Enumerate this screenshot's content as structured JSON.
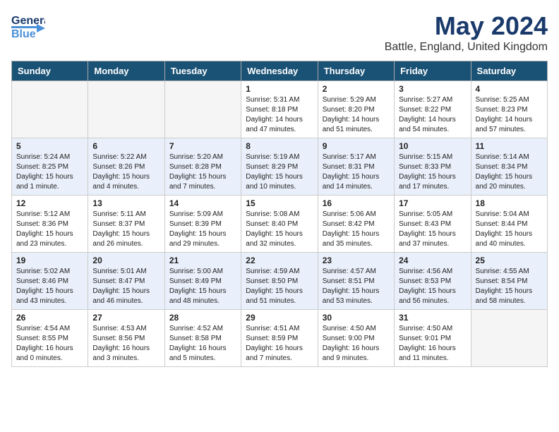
{
  "header": {
    "logo_line1": "General",
    "logo_line2": "Blue",
    "title": "May 2024",
    "subtitle": "Battle, England, United Kingdom"
  },
  "days_of_week": [
    "Sunday",
    "Monday",
    "Tuesday",
    "Wednesday",
    "Thursday",
    "Friday",
    "Saturday"
  ],
  "weeks": [
    [
      {
        "day": "",
        "info": ""
      },
      {
        "day": "",
        "info": ""
      },
      {
        "day": "",
        "info": ""
      },
      {
        "day": "1",
        "info": "Sunrise: 5:31 AM\nSunset: 8:18 PM\nDaylight: 14 hours\nand 47 minutes."
      },
      {
        "day": "2",
        "info": "Sunrise: 5:29 AM\nSunset: 8:20 PM\nDaylight: 14 hours\nand 51 minutes."
      },
      {
        "day": "3",
        "info": "Sunrise: 5:27 AM\nSunset: 8:22 PM\nDaylight: 14 hours\nand 54 minutes."
      },
      {
        "day": "4",
        "info": "Sunrise: 5:25 AM\nSunset: 8:23 PM\nDaylight: 14 hours\nand 57 minutes."
      }
    ],
    [
      {
        "day": "5",
        "info": "Sunrise: 5:24 AM\nSunset: 8:25 PM\nDaylight: 15 hours\nand 1 minute."
      },
      {
        "day": "6",
        "info": "Sunrise: 5:22 AM\nSunset: 8:26 PM\nDaylight: 15 hours\nand 4 minutes."
      },
      {
        "day": "7",
        "info": "Sunrise: 5:20 AM\nSunset: 8:28 PM\nDaylight: 15 hours\nand 7 minutes."
      },
      {
        "day": "8",
        "info": "Sunrise: 5:19 AM\nSunset: 8:29 PM\nDaylight: 15 hours\nand 10 minutes."
      },
      {
        "day": "9",
        "info": "Sunrise: 5:17 AM\nSunset: 8:31 PM\nDaylight: 15 hours\nand 14 minutes."
      },
      {
        "day": "10",
        "info": "Sunrise: 5:15 AM\nSunset: 8:33 PM\nDaylight: 15 hours\nand 17 minutes."
      },
      {
        "day": "11",
        "info": "Sunrise: 5:14 AM\nSunset: 8:34 PM\nDaylight: 15 hours\nand 20 minutes."
      }
    ],
    [
      {
        "day": "12",
        "info": "Sunrise: 5:12 AM\nSunset: 8:36 PM\nDaylight: 15 hours\nand 23 minutes."
      },
      {
        "day": "13",
        "info": "Sunrise: 5:11 AM\nSunset: 8:37 PM\nDaylight: 15 hours\nand 26 minutes."
      },
      {
        "day": "14",
        "info": "Sunrise: 5:09 AM\nSunset: 8:39 PM\nDaylight: 15 hours\nand 29 minutes."
      },
      {
        "day": "15",
        "info": "Sunrise: 5:08 AM\nSunset: 8:40 PM\nDaylight: 15 hours\nand 32 minutes."
      },
      {
        "day": "16",
        "info": "Sunrise: 5:06 AM\nSunset: 8:42 PM\nDaylight: 15 hours\nand 35 minutes."
      },
      {
        "day": "17",
        "info": "Sunrise: 5:05 AM\nSunset: 8:43 PM\nDaylight: 15 hours\nand 37 minutes."
      },
      {
        "day": "18",
        "info": "Sunrise: 5:04 AM\nSunset: 8:44 PM\nDaylight: 15 hours\nand 40 minutes."
      }
    ],
    [
      {
        "day": "19",
        "info": "Sunrise: 5:02 AM\nSunset: 8:46 PM\nDaylight: 15 hours\nand 43 minutes."
      },
      {
        "day": "20",
        "info": "Sunrise: 5:01 AM\nSunset: 8:47 PM\nDaylight: 15 hours\nand 46 minutes."
      },
      {
        "day": "21",
        "info": "Sunrise: 5:00 AM\nSunset: 8:49 PM\nDaylight: 15 hours\nand 48 minutes."
      },
      {
        "day": "22",
        "info": "Sunrise: 4:59 AM\nSunset: 8:50 PM\nDaylight: 15 hours\nand 51 minutes."
      },
      {
        "day": "23",
        "info": "Sunrise: 4:57 AM\nSunset: 8:51 PM\nDaylight: 15 hours\nand 53 minutes."
      },
      {
        "day": "24",
        "info": "Sunrise: 4:56 AM\nSunset: 8:53 PM\nDaylight: 15 hours\nand 56 minutes."
      },
      {
        "day": "25",
        "info": "Sunrise: 4:55 AM\nSunset: 8:54 PM\nDaylight: 15 hours\nand 58 minutes."
      }
    ],
    [
      {
        "day": "26",
        "info": "Sunrise: 4:54 AM\nSunset: 8:55 PM\nDaylight: 16 hours\nand 0 minutes."
      },
      {
        "day": "27",
        "info": "Sunrise: 4:53 AM\nSunset: 8:56 PM\nDaylight: 16 hours\nand 3 minutes."
      },
      {
        "day": "28",
        "info": "Sunrise: 4:52 AM\nSunset: 8:58 PM\nDaylight: 16 hours\nand 5 minutes."
      },
      {
        "day": "29",
        "info": "Sunrise: 4:51 AM\nSunset: 8:59 PM\nDaylight: 16 hours\nand 7 minutes."
      },
      {
        "day": "30",
        "info": "Sunrise: 4:50 AM\nSunset: 9:00 PM\nDaylight: 16 hours\nand 9 minutes."
      },
      {
        "day": "31",
        "info": "Sunrise: 4:50 AM\nSunset: 9:01 PM\nDaylight: 16 hours\nand 11 minutes."
      },
      {
        "day": "",
        "info": ""
      }
    ]
  ]
}
